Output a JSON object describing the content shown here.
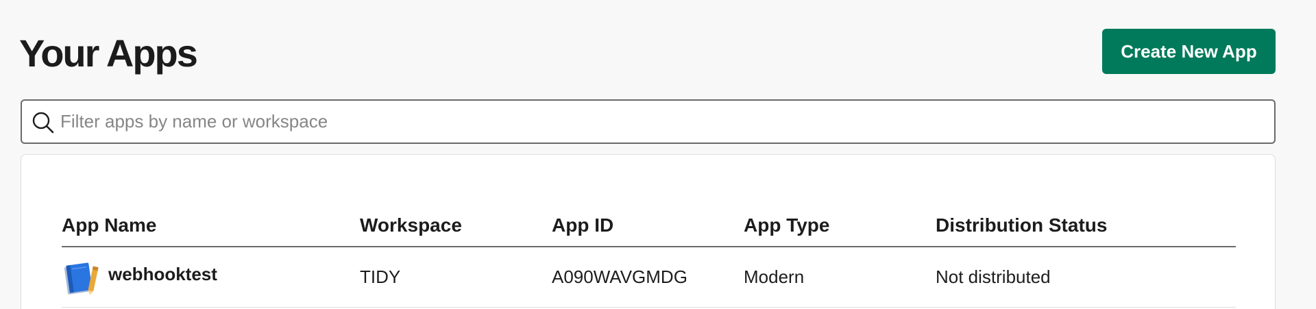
{
  "header": {
    "title": "Your Apps",
    "create_button_label": "Create New App"
  },
  "search": {
    "placeholder": "Filter apps by name or workspace",
    "value": ""
  },
  "table": {
    "columns": [
      "App Name",
      "Workspace",
      "App ID",
      "App Type",
      "Distribution Status"
    ],
    "rows": [
      {
        "icon": "notebook-icon",
        "app_name": "webhooktest",
        "workspace": "TIDY",
        "app_id": "A090WAVGMDG",
        "app_type": "Modern",
        "distribution_status": "Not distributed"
      }
    ]
  },
  "colors": {
    "accent": "#007a5a",
    "background": "#f8f8f8"
  }
}
